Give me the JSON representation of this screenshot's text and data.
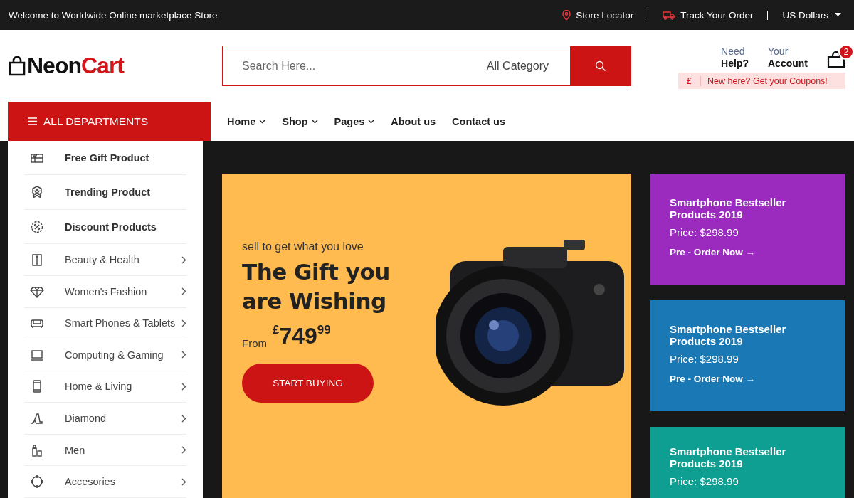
{
  "top_bar": {
    "welcome": "Welcome to Worldwide Online marketplace Store",
    "links": [
      {
        "kind": "locator",
        "label": "Store Locator"
      },
      {
        "kind": "track",
        "label": "Track Your Order"
      }
    ],
    "currency": "US Dollars"
  },
  "header": {
    "logo": {
      "part_1": "Neon",
      "part_2": "Cart"
    },
    "search": {
      "placeholder": "Search Here...",
      "category": "All Category"
    },
    "help": {
      "line_1": "Need",
      "line_2": "Help?"
    },
    "account": {
      "line_1": "Your",
      "line_2": "Account"
    },
    "cart_count": "2",
    "coupon": {
      "symbol": "£",
      "text": "New here? Get your Coupons!"
    }
  },
  "nav": {
    "departments": "ALL DEPARTMENTS",
    "links": [
      {
        "label": "Home",
        "dropdown": true
      },
      {
        "label": "Shop",
        "dropdown": true
      },
      {
        "label": "Pages",
        "dropdown": true
      },
      {
        "label": "About us",
        "dropdown": false
      },
      {
        "label": "Contact us",
        "dropdown": false
      }
    ]
  },
  "sidebar": {
    "items": [
      {
        "kind": "featured",
        "label": "Free Gift Product"
      },
      {
        "kind": "featured",
        "label": "Trending Product"
      },
      {
        "kind": "featured",
        "label": "Discount Products"
      },
      {
        "kind": "category",
        "label": "Beauty & Health"
      },
      {
        "kind": "category",
        "label": "Women's Fashion"
      },
      {
        "kind": "category",
        "label": "Smart Phones & Tablets"
      },
      {
        "kind": "category",
        "label": "Computing & Gaming"
      },
      {
        "kind": "category",
        "label": "Home & Living"
      },
      {
        "kind": "category",
        "label": "Diamond"
      },
      {
        "kind": "category",
        "label": "Men"
      },
      {
        "kind": "category",
        "label": "Accesories"
      }
    ]
  },
  "hero": {
    "tagline": "sell to get what you love",
    "title": "The Gift you are Wishing",
    "from": "From",
    "price": "$^{£}$749$^{99}$",
    "button": "START BUYING"
  },
  "promo_cards": [
    {
      "color": "#9b2bbf",
      "title": "Smartphone Bestseller Products 2019",
      "price": "Price: $298.99",
      "link": "Pre - Order Now →"
    },
    {
      "color": "#1a78b4",
      "title": "Smartphone Bestseller Products 2019",
      "price": "Price: $298.99",
      "link": "Pre - Order Now →"
    },
    {
      "color": "#0f9e92",
      "title": "Smartphone Bestseller Products 2019",
      "price": "Price: $298.99"
    }
  ]
}
